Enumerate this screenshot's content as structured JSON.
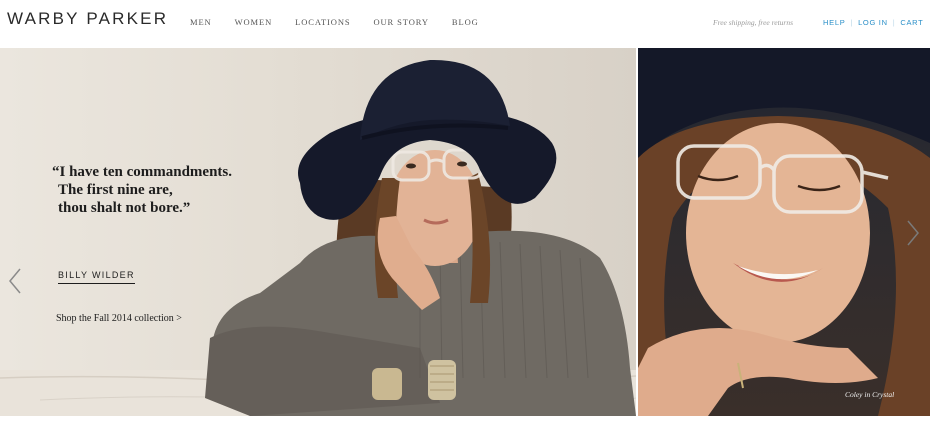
{
  "header": {
    "logo": "WARBY PARKER",
    "nav": [
      {
        "label": "MEN"
      },
      {
        "label": "WOMEN"
      },
      {
        "label": "LOCATIONS"
      },
      {
        "label": "OUR STORY"
      },
      {
        "label": "BLOG"
      }
    ],
    "tagline": "Free shipping, free returns",
    "utility": {
      "help": "HELP",
      "login": "LOG IN",
      "cart": "CART"
    }
  },
  "hero": {
    "quote_lines": [
      "“I have ten commandments.",
      "The first nine are,",
      "thou shalt not bore.”"
    ],
    "author": "BILLY WILDER",
    "cta": "Shop the Fall 2014 collection >",
    "caption": "Coley in Crystal"
  },
  "icons": {
    "prev": "chevron-left-icon",
    "next": "chevron-right-icon"
  },
  "colors": {
    "link_blue": "#2a8fc8",
    "hat": "#15192a",
    "sweater": "#6f6a63"
  }
}
